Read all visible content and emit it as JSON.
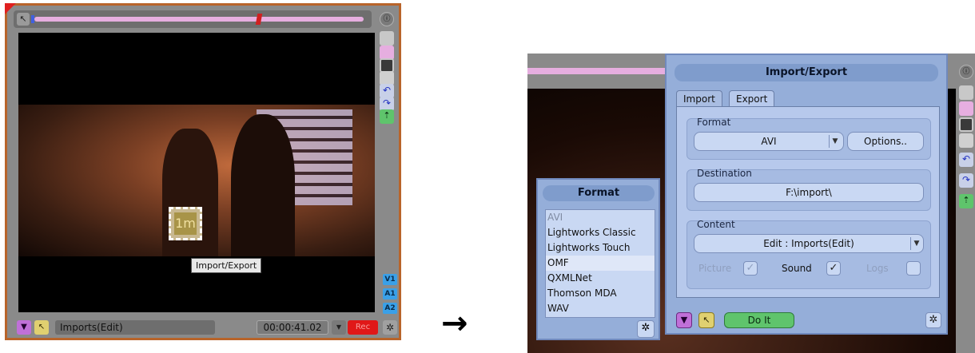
{
  "viewer": {
    "timecode": "00:00:41.02",
    "clip_name": "Imports(Edit)",
    "tooltip": "Import/Export",
    "record_label": "Rec",
    "tracks": [
      "V1",
      "A1",
      "A2"
    ],
    "icon_label": "1m"
  },
  "arrow": "→",
  "dialog": {
    "title": "Import/Export",
    "tabs": [
      "Import",
      "Export"
    ],
    "active_tab": "Export",
    "format_label": "Format",
    "format_value": "AVI",
    "options_label": "Options..",
    "destination_label": "Destination",
    "destination_value": "F:\\import\\",
    "content_label": "Content",
    "content_value": "Edit : Imports(Edit)",
    "picture_label": "Picture",
    "sound_label": "Sound",
    "logs_label": "Logs",
    "picture_checked": true,
    "sound_checked": true,
    "logs_checked": false,
    "do_it_label": "Do It"
  },
  "format_panel": {
    "title": "Format",
    "items": [
      "AVI",
      "Lightworks Classic",
      "Lightworks Touch",
      "OMF",
      "QXMLNet",
      "Thomson MDA",
      "WAV"
    ],
    "selected": "OMF",
    "disabled": "AVI"
  },
  "colors": {
    "accent_pink": "#e6aee0",
    "frame_orange": "#b8642a",
    "dialog_blue": "#95aed9",
    "do_it_green": "#5fc46c",
    "rec_red": "#e01818",
    "track_blue": "#3aa0e8"
  }
}
